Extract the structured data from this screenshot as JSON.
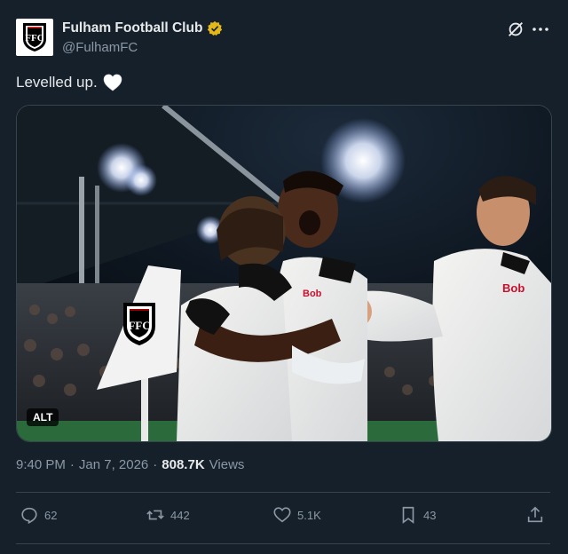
{
  "author": {
    "display_name": "Fulham Football Club",
    "handle": "@FulhamFC",
    "avatar_icon": "fulham-crest-icon",
    "verified_color": "#e2b719"
  },
  "tweet": {
    "text": "Levelled up.",
    "emoji": "white-heart-icon"
  },
  "media": {
    "alt_label": "ALT",
    "corner_flag_text": "FFC",
    "shirt_sponsor": "Bob"
  },
  "meta": {
    "time": "9:40 PM",
    "separator1": "·",
    "date": "Jan 7, 2026",
    "separator2": "·",
    "views_count": "808.7K",
    "views_label": "Views"
  },
  "actions": {
    "replies": "62",
    "reposts": "442",
    "likes": "5.1K",
    "bookmarks": "43"
  },
  "colors": {
    "background": "#15202b",
    "text": "#e7e9ea",
    "secondary": "#8b98a5",
    "border": "#38444d"
  }
}
